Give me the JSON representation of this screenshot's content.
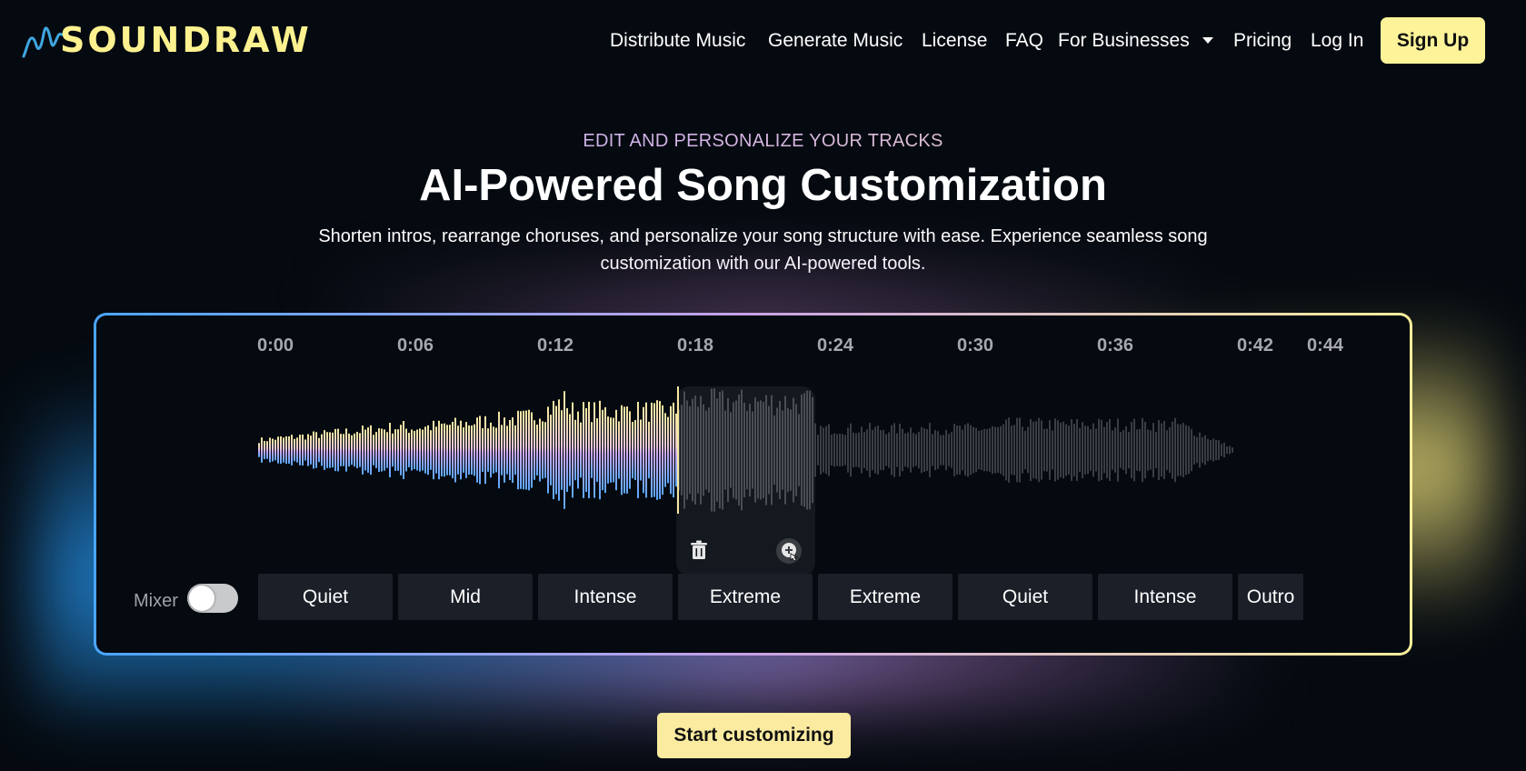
{
  "brand": {
    "name": "SOUNDRAW"
  },
  "nav": {
    "items": [
      {
        "label": "Distribute Music"
      },
      {
        "label": "Generate Music"
      },
      {
        "label": "License"
      },
      {
        "label": "FAQ"
      },
      {
        "label": "For Businesses"
      },
      {
        "label": "Pricing"
      },
      {
        "label": "Log In"
      }
    ],
    "signup_label": "Sign Up"
  },
  "hero": {
    "eyebrow": "EDIT AND PERSONALIZE YOUR TRACKS",
    "title": "AI-Powered Song Customization",
    "subtitle": "Shorten intros, rearrange choruses, and personalize your song structure with ease. Experience seamless song customization with our AI-powered tools."
  },
  "editor": {
    "timeline": [
      "0:00",
      "0:06",
      "0:12",
      "0:18",
      "0:24",
      "0:30",
      "0:36",
      "0:42",
      "0:44"
    ],
    "mixer_label": "Mixer",
    "mixer_on": false,
    "segments": [
      {
        "label": "Quiet"
      },
      {
        "label": "Mid"
      },
      {
        "label": "Intense"
      },
      {
        "label": "Extreme"
      },
      {
        "label": "Extreme"
      },
      {
        "label": "Quiet"
      },
      {
        "label": "Intense"
      },
      {
        "label": "Outro"
      }
    ],
    "selected_segment_index": 3,
    "icons": {
      "delete": "trash-icon",
      "duplicate": "duplicate-icon"
    }
  },
  "cta": {
    "label": "Start customizing"
  },
  "colors": {
    "accent": "#fdf49a",
    "background": "#050a10",
    "wave_played_top": "#f6e8a0",
    "wave_played_mid": "#d5a6ee",
    "wave_played_bottom": "#5aa7ff",
    "wave_unplayed": "#3a3d42"
  }
}
